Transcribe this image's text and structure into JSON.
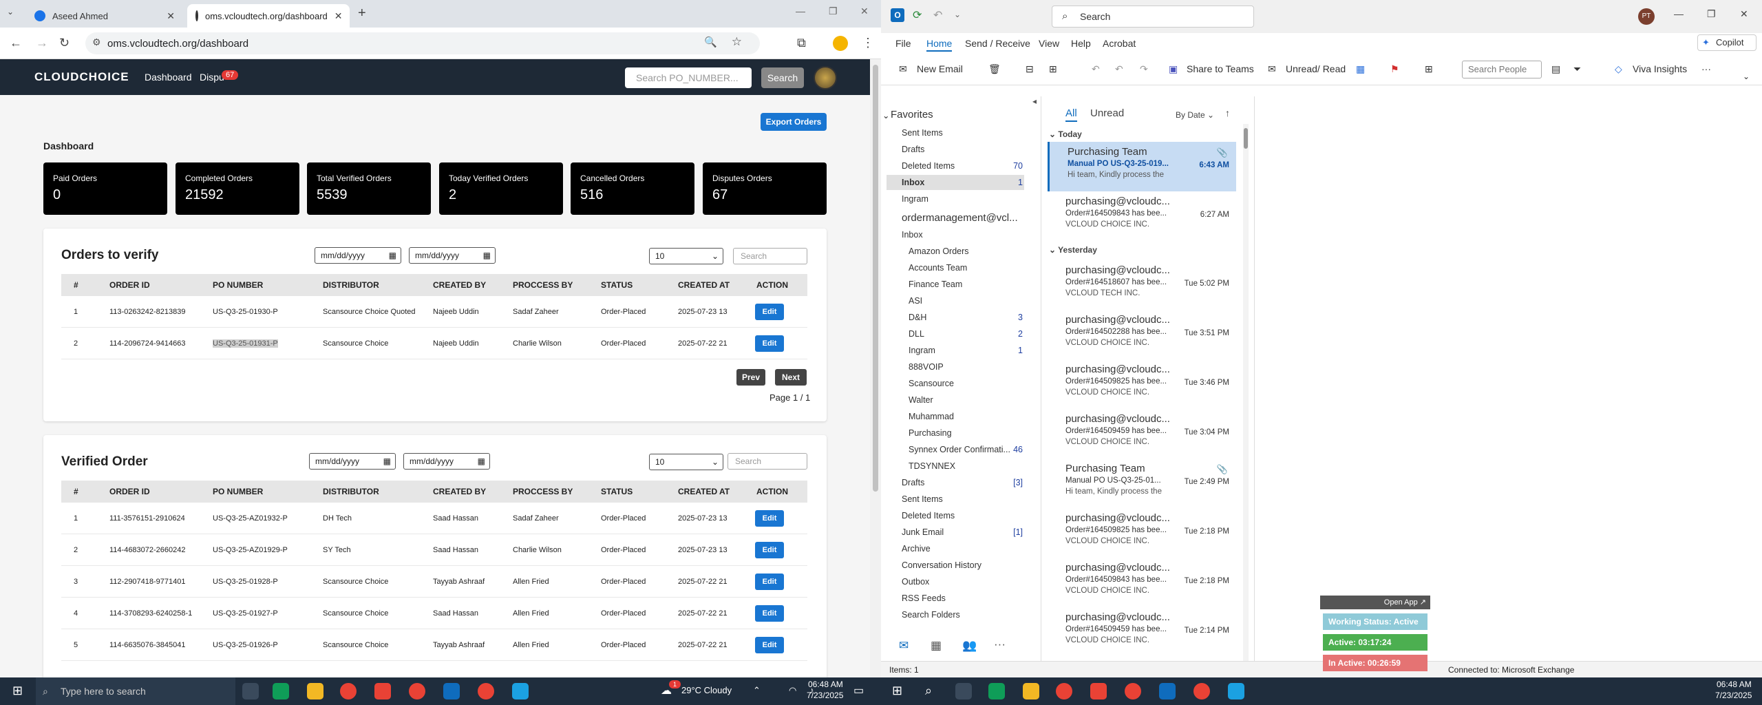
{
  "browser": {
    "tabs": [
      {
        "title": "Aseed Ahmed"
      },
      {
        "title": "oms.vcloudtech.org/dashboard"
      }
    ],
    "url": "oms.vcloudtech.org/dashboard"
  },
  "site": {
    "logo": "CLOUDCHOICE",
    "nav": {
      "dashboard": "Dashboard",
      "disputes": "Dispu",
      "disputes_badge": "67"
    },
    "search_placeholder": "Search PO_NUMBER...",
    "search_button": "Search",
    "export_button": "Export Orders",
    "page_title": "Dashboard",
    "stats": [
      {
        "label": "Paid Orders",
        "value": "0"
      },
      {
        "label": "Completed Orders",
        "value": "21592"
      },
      {
        "label": "Total Verified Orders",
        "value": "5539"
      },
      {
        "label": "Today Verified Orders",
        "value": "2"
      },
      {
        "label": "Cancelled Orders",
        "value": "516"
      },
      {
        "label": "Disputes Orders",
        "value": "67"
      }
    ],
    "date_placeholder": "mm/dd/yyyy",
    "page_size": "10",
    "table_search": "Search",
    "columns": [
      "#",
      "ORDER ID",
      "PO NUMBER",
      "DISTRIBUTOR",
      "CREATED BY",
      "PROCCESS BY",
      "STATUS",
      "CREATED AT",
      "ACTION"
    ],
    "verify": {
      "title": "Orders to verify",
      "rows": [
        {
          "n": "1",
          "order_id": "113-0263242-8213839",
          "po": "US-Q3-25-01930-P",
          "dist": "Scansource Choice Quoted",
          "created_by": "Najeeb Uddin",
          "proc_by": "Sadaf Zaheer",
          "status": "Order-Placed",
          "created_at": "2025-07-23 13"
        },
        {
          "n": "2",
          "order_id": "114-2096724-9414663",
          "po": "US-Q3-25-01931-P",
          "dist": "Scansource Choice",
          "created_by": "Najeeb Uddin",
          "proc_by": "Charlie Wilson",
          "status": "Order-Placed",
          "created_at": "2025-07-22 21"
        }
      ],
      "prev": "Prev",
      "next": "Next",
      "page_info": "Page 1 / 1"
    },
    "verified": {
      "title": "Verified Order",
      "rows": [
        {
          "n": "1",
          "order_id": "111-3576151-2910624",
          "po": "US-Q3-25-AZ01932-P",
          "dist": "DH Tech",
          "created_by": "Saad Hassan",
          "proc_by": "Sadaf Zaheer",
          "status": "Order-Placed",
          "created_at": "2025-07-23 13"
        },
        {
          "n": "2",
          "order_id": "114-4683072-2660242",
          "po": "US-Q3-25-AZ01929-P",
          "dist": "SY Tech",
          "created_by": "Saad Hassan",
          "proc_by": "Charlie Wilson",
          "status": "Order-Placed",
          "created_at": "2025-07-23 13"
        },
        {
          "n": "3",
          "order_id": "112-2907418-9771401",
          "po": "US-Q3-25-01928-P",
          "dist": "Scansource Choice",
          "created_by": "Tayyab Ashraaf",
          "proc_by": "Allen Fried",
          "status": "Order-Placed",
          "created_at": "2025-07-22 21"
        },
        {
          "n": "4",
          "order_id": "114-3708293-6240258-1",
          "po": "US-Q3-25-01927-P",
          "dist": "Scansource Choice",
          "created_by": "Saad Hassan",
          "proc_by": "Allen Fried",
          "status": "Order-Placed",
          "created_at": "2025-07-22 21"
        },
        {
          "n": "5",
          "order_id": "114-6635076-3845041",
          "po": "US-Q3-25-01926-P",
          "dist": "Scansource Choice",
          "created_by": "Tayyab Ashraaf",
          "proc_by": "Allen Fried",
          "status": "Order-Placed",
          "created_at": "2025-07-22 21"
        }
      ]
    },
    "edit_label": "Edit"
  },
  "outlook": {
    "search": "Search",
    "profile": "PT",
    "copilot": "Copilot",
    "menu": [
      "File",
      "Home",
      "Send / Receive",
      "View",
      "Help",
      "Acrobat"
    ],
    "ribbon": {
      "new_email": "New Email",
      "share_teams": "Share to Teams",
      "unread_read": "Unread/ Read",
      "search_people": "Search People",
      "viva": "Viva Insights"
    },
    "favorites_label": "Favorites",
    "favorites": [
      {
        "name": "Sent Items",
        "count": ""
      },
      {
        "name": "Drafts",
        "count": ""
      },
      {
        "name": "Deleted Items",
        "count": "70"
      },
      {
        "name": "Inbox",
        "count": "1"
      },
      {
        "name": "Ingram",
        "count": ""
      }
    ],
    "account": "ordermanagement@vcl...",
    "inbox_label": "Inbox",
    "subfolders": [
      {
        "name": "Amazon Orders",
        "count": ""
      },
      {
        "name": "Accounts Team",
        "count": ""
      },
      {
        "name": "Finance Team",
        "count": ""
      },
      {
        "name": "ASI",
        "count": ""
      },
      {
        "name": "D&H",
        "count": "3"
      },
      {
        "name": "DLL",
        "count": "2"
      },
      {
        "name": "Ingram",
        "count": "1"
      },
      {
        "name": "888VOIP",
        "count": ""
      },
      {
        "name": "Scansource",
        "count": ""
      },
      {
        "name": "Walter",
        "count": ""
      },
      {
        "name": "Muhammad",
        "count": ""
      },
      {
        "name": "Purchasing",
        "count": ""
      },
      {
        "name": "Synnex Order Confirmati...",
        "count": "46"
      },
      {
        "name": "TDSYNNEX",
        "count": ""
      }
    ],
    "rootfolders": [
      {
        "name": "Drafts",
        "count": "[3]"
      },
      {
        "name": "Sent Items",
        "count": ""
      },
      {
        "name": "Deleted Items",
        "count": ""
      },
      {
        "name": "Junk Email",
        "count": "[1]"
      },
      {
        "name": "Archive",
        "count": ""
      },
      {
        "name": "Conversation History",
        "count": ""
      },
      {
        "name": "Outbox",
        "count": ""
      },
      {
        "name": "RSS Feeds",
        "count": ""
      },
      {
        "name": "Search Folders",
        "count": ""
      }
    ],
    "filters": {
      "all": "All",
      "unread": "Unread",
      "sort": "By Date"
    },
    "group_today": "Today",
    "group_yesterday": "Yesterday",
    "messages": [
      {
        "from": "Purchasing Team",
        "subj": "Manual PO   US-Q3-25-019...",
        "time": "6:43 AM",
        "prev": "Hi team,  Kindly process the"
      },
      {
        "from": "purchasing@vcloudc...",
        "subj": "Order#164509843 has bee...",
        "time": "6:27 AM",
        "prev": "VCLOUD CHOICE INC."
      },
      {
        "from": "purchasing@vcloudc...",
        "subj": "Order#164518607 has bee...",
        "time": "Tue 5:02 PM",
        "prev": "VCLOUD TECH INC."
      },
      {
        "from": "purchasing@vcloudc...",
        "subj": "Order#164502288 has bee...",
        "time": "Tue 3:51 PM",
        "prev": "VCLOUD CHOICE INC."
      },
      {
        "from": "purchasing@vcloudc...",
        "subj": "Order#164509825 has bee...",
        "time": "Tue 3:46 PM",
        "prev": "VCLOUD CHOICE INC."
      },
      {
        "from": "purchasing@vcloudc...",
        "subj": "Order#164509459 has bee...",
        "time": "Tue 3:04 PM",
        "prev": "VCLOUD CHOICE INC."
      },
      {
        "from": "Purchasing Team",
        "subj": "Manual PO   US-Q3-25-01...",
        "time": "Tue 2:49 PM",
        "prev": "Hi team,  Kindly process the"
      },
      {
        "from": "purchasing@vcloudc...",
        "subj": "Order#164509825 has bee...",
        "time": "Tue 2:18 PM",
        "prev": "VCLOUD CHOICE INC."
      },
      {
        "from": "purchasing@vcloudc...",
        "subj": "Order#164509843 has bee...",
        "time": "Tue 2:18 PM",
        "prev": "VCLOUD CHOICE INC."
      },
      {
        "from": "purchasing@vcloudc...",
        "subj": "Order#164509459 has bee...",
        "time": "Tue 2:14 PM",
        "prev": "VCLOUD CHOICE INC."
      }
    ],
    "status_items": "Items: 1",
    "status_conn": "Connected to: Microsoft Exchange",
    "widget": {
      "open": "Open App ↗",
      "working": "Working Status: Active",
      "active": "Active: 03:17:24",
      "inactive": "In Active: 00:26:59"
    }
  },
  "taskbar": {
    "search": "Type here to search",
    "weather": "29°C  Cloudy",
    "time": "06:48 AM",
    "date": "7/23/2025",
    "weather_badge": "1"
  }
}
